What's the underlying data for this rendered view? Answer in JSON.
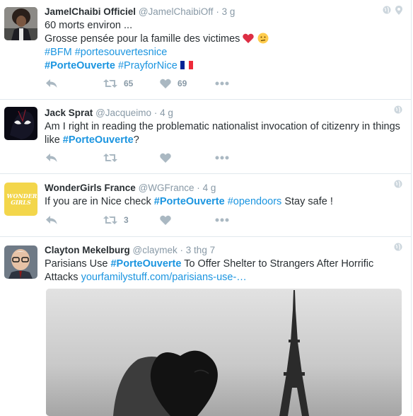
{
  "tweets": [
    {
      "fullname": "JamelChaibi Officiel",
      "username": "@JamelChaibiOff",
      "dot": "·",
      "time": "3 g",
      "lines": [
        "60 morts environ  ...",
        "Grosse pensée pour la famille des victimes"
      ],
      "hashtags_line1": "#BFM #portesouvertesnice",
      "hashtag_strong": "#PorteOuverte",
      "hashtag_after": " #PrayforNice",
      "retweet_count": "65",
      "like_count": "69",
      "icons": [
        "globe-icon",
        "location-pin-icon",
        "heart-emoji",
        "confused-face-emoji",
        "flag-france-emoji"
      ]
    },
    {
      "fullname": "Jack Sprat",
      "username": "@Jacqueimo",
      "dot": "·",
      "time": "4 g",
      "text_before": "Am I right in reading the problematic nationalist invocation of citizenry in things like ",
      "hashtag_strong": "#PorteOuverte",
      "text_after": "?",
      "retweet_count": "",
      "like_count": ""
    },
    {
      "fullname": "WonderGirls France",
      "username": "@WGFrance",
      "dot": "·",
      "time": "4 g",
      "avatar_text": "WONDER GIRLS",
      "text_before": "If you are in Nice check ",
      "hashtag_strong": "#PorteOuverte",
      "hashtag_plain": " #opendoors",
      "text_after": " Stay safe !",
      "retweet_count": "3",
      "like_count": ""
    },
    {
      "fullname": "Clayton Mekelburg",
      "username": "@claymek",
      "dot": "·",
      "time": "3 thg 7",
      "text_before": "Parisians Use ",
      "hashtag_strong": "#PorteOuverte",
      "text_after": " To Offer Shelter to Strangers After Horrific Attacks ",
      "link": "yourfamilystuff.com/parisians-use-…"
    }
  ],
  "colors": {
    "link": "#1b95e0",
    "muted": "#8899a6",
    "icon": "#aab8c2",
    "border": "#e1e8ed"
  }
}
